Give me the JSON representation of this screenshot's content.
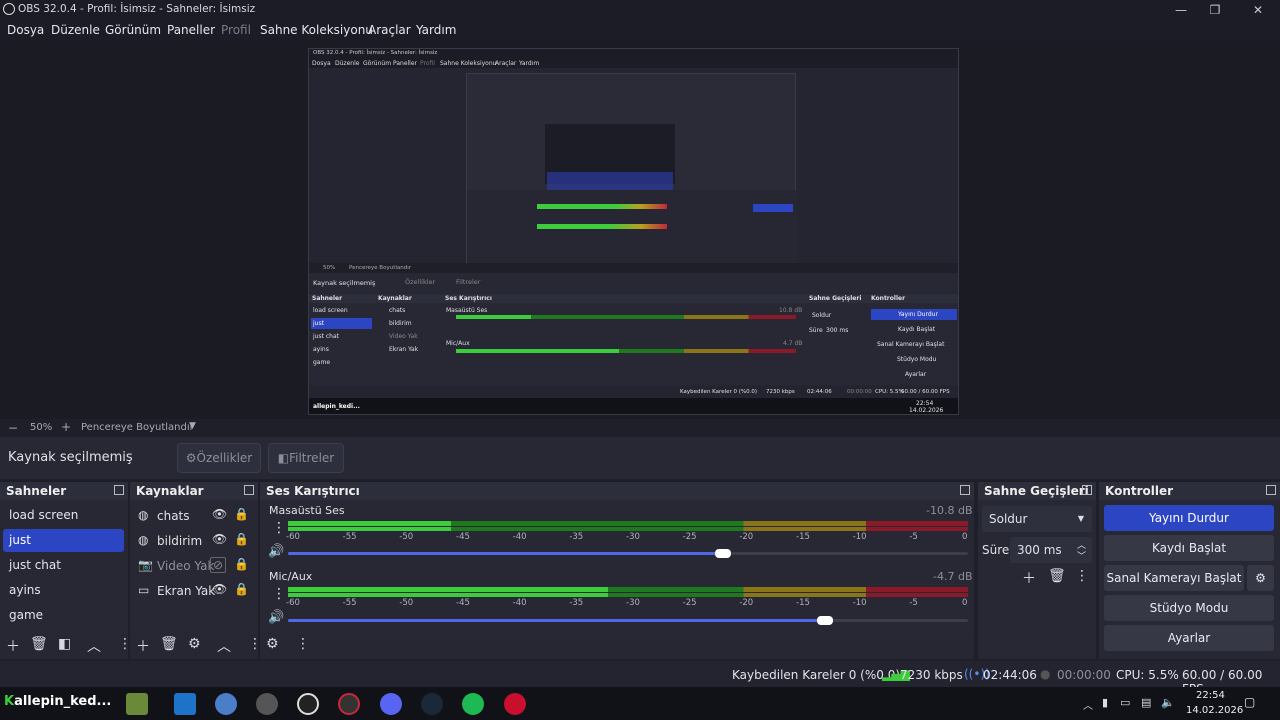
{
  "window": {
    "title": "OBS 32.0.4 - Profil: İsimsiz - Sahneler: İsimsiz"
  },
  "menu": [
    "Dosya",
    "Düzenle",
    "Görünüm",
    "Paneller",
    "Profil",
    "Sahne Koleksiyonu",
    "Araçlar",
    "Yardım"
  ],
  "nested_preview": {
    "title": "OBS 32.0.4 - Profil: İsimsiz - Sahneler: İsimsiz",
    "menu": [
      "Dosya",
      "Düzenle",
      "Görünüm",
      "Paneller",
      "Profil",
      "Sahne Koleksiyonu",
      "Araçlar",
      "Yardım"
    ],
    "zoom": "50%",
    "zoom_mode": "Pencereye Boyutlandır",
    "no_source": "Kaynak seçilmemiş",
    "props": "Özellikler",
    "filters": "Filtreler",
    "docks": [
      "Sahneler",
      "Kaynaklar",
      "Ses Karıştırıcı",
      "Sahne Geçişleri",
      "Kontroller"
    ],
    "scenes": [
      "load screen",
      "just",
      "just chat",
      "ayins",
      "game"
    ],
    "sources": [
      "chats",
      "bildirim",
      "Video Yak",
      "Ekran Yak"
    ],
    "tracks": [
      {
        "name": "Masaüstü Ses",
        "db": "10.8 dB"
      },
      {
        "name": "Mic/Aux",
        "db": "4.7 dB"
      }
    ],
    "transition": "Soldur",
    "duration_label": "Süre",
    "duration": "300 ms",
    "controls": [
      "Yayını Durdur",
      "Kaydı Başlat",
      "Sanal Kamerayı Başlat",
      "Stüdyo Modu",
      "Ayarlar"
    ],
    "status": {
      "dropped": "Kaybedilen Kareler 0 (%0.0)",
      "bitrate": "7230 kbps",
      "time": "02:44:06",
      "rec": "00:00:00",
      "cpu": "CPU: 5.5%",
      "fps": "60.00 / 60.00 FPS"
    },
    "taskbar_user": "allepin_kedi...",
    "clock_time": "22:54",
    "clock_date": "14.02.2026"
  },
  "zoom": {
    "minus": "−",
    "value": "50%",
    "plus": "+",
    "mode": "Pencereye Boyutlandır"
  },
  "source_bar": {
    "no_source": "Kaynak seçilmemiş",
    "properties": "Özellikler",
    "filters": "Filtreler"
  },
  "scenes_dock": {
    "title": "Sahneler",
    "items": [
      "load screen",
      "just",
      "just chat",
      "ayins",
      "game"
    ],
    "selected_index": 1
  },
  "sources_dock": {
    "title": "Kaynaklar",
    "items": [
      {
        "name": "chats",
        "icon": "browser-icon",
        "visible": true
      },
      {
        "name": "bildirim",
        "icon": "browser-icon",
        "visible": true
      },
      {
        "name": "Video Yak",
        "icon": "camera-icon",
        "visible": false
      },
      {
        "name": "Ekran Yak",
        "icon": "monitor-icon",
        "visible": true
      }
    ]
  },
  "mixer": {
    "title": "Ses Karıştırıcı",
    "scale": [
      "-60",
      "-55",
      "-50",
      "-45",
      "-40",
      "-35",
      "-30",
      "-25",
      "-20",
      "-15",
      "-10",
      "-5",
      "0"
    ],
    "tracks": [
      {
        "name": "Masaüstü Ses",
        "db": "-10.8 dB",
        "level": 0.24,
        "volume": 0.64
      },
      {
        "name": "Mic/Aux",
        "db": "-4.7 dB",
        "level": 0.47,
        "volume": 0.79
      }
    ]
  },
  "transitions": {
    "title": "Sahne Geçişleri",
    "selected": "Soldur",
    "duration_label": "Süre",
    "duration": "300 ms"
  },
  "controls": {
    "title": "Kontroller",
    "stop_stream": "Yayını Durdur",
    "start_record": "Kaydı Başlat",
    "start_vcam": "Sanal Kamerayı Başlat",
    "studio_mode": "Stüdyo Modu",
    "settings": "Ayarlar"
  },
  "status": {
    "dropped": "Kaybedilen Kareler 0 (%0.0)",
    "bitrate": "7230 kbps",
    "stream_time": "02:44:06",
    "rec_time": "00:00:00",
    "cpu": "CPU: 5.5%",
    "fps": "60.00 / 60.00 FPS"
  },
  "taskbar": {
    "user": "allepin_ked...",
    "time": "22:54",
    "date": "14.02.2026"
  },
  "colors": {
    "accent": "#2c45c2",
    "meter_green": "#3ccc3c",
    "meter_yellow": "#b8a020",
    "meter_red": "#c0283a"
  }
}
